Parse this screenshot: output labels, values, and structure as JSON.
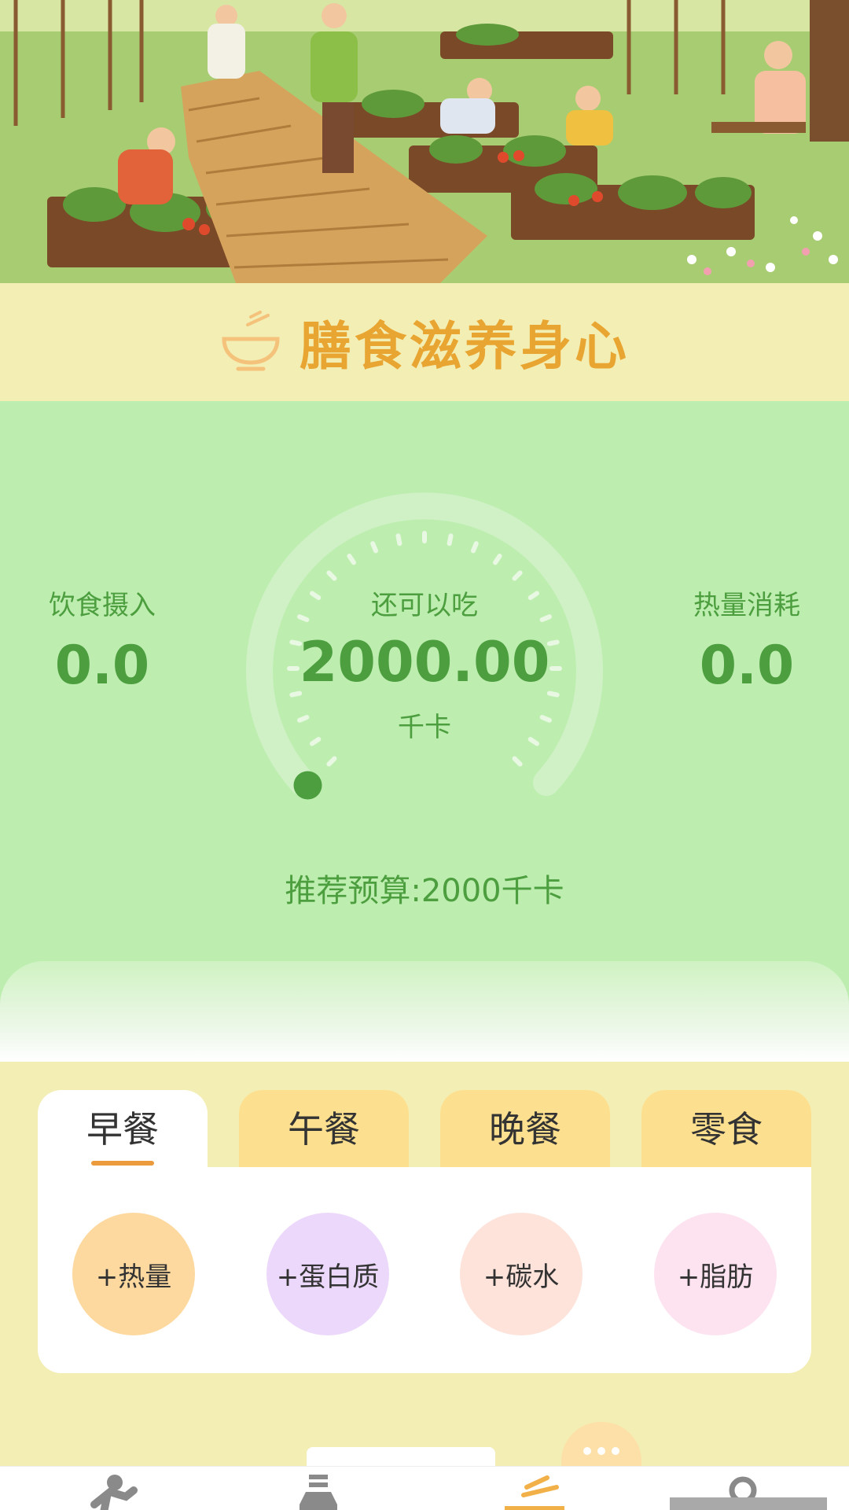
{
  "header": {
    "title": "膳食滋养身心",
    "icon": "bowl-icon"
  },
  "summary": {
    "intake": {
      "label": "饮食摄入",
      "value": "0.0"
    },
    "remaining": {
      "label": "还可以吃",
      "value": "2000.00",
      "unit": "千卡",
      "progress_fraction": 0
    },
    "burned": {
      "label": "热量消耗",
      "value": "0.0"
    },
    "budget": "推荐预算:2000千卡"
  },
  "meals": {
    "tabs": [
      {
        "label": "早餐",
        "active": true
      },
      {
        "label": "午餐",
        "active": false
      },
      {
        "label": "晚餐",
        "active": false
      },
      {
        "label": "零食",
        "active": false
      }
    ],
    "actions": [
      {
        "label": "+热量",
        "color": "#fdd99f"
      },
      {
        "label": "+蛋白质",
        "color": "#ecd8fb"
      },
      {
        "label": "+碳水",
        "color": "#fde3da"
      },
      {
        "label": "+脂肪",
        "color": "#fde3f0"
      }
    ]
  },
  "nav": {
    "items": [
      {
        "icon": "runner-icon"
      },
      {
        "icon": "bottle-icon"
      },
      {
        "icon": "bowl-icon",
        "active": true
      },
      {
        "icon": "profile-icon"
      }
    ]
  },
  "colors": {
    "accent": "#e8a531",
    "green": "#4c9e3e",
    "summary_bg": "#bdeeb0",
    "page_bg": "#f3eeb4"
  }
}
